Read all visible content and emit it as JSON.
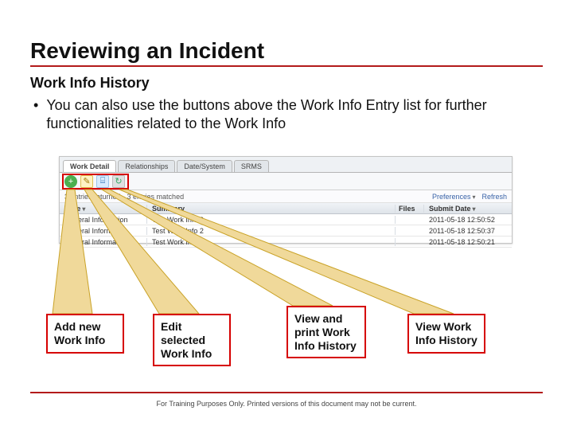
{
  "title": "Reviewing an Incident",
  "subtitle": "Work Info History",
  "bullet": "You can also use the buttons above the Work Info Entry list for further functionalities related to the Work Info",
  "footer": "For Training Purposes Only. Printed versions of this document may not be current.",
  "panel": {
    "tabs": [
      "Work Detail",
      "Relationships",
      "Date/System",
      "SRMS"
    ],
    "active_tab": 0,
    "status_left": "3 entries returned - 3 entries matched",
    "status_preferences": "Preferences",
    "status_refresh": "Refresh",
    "columns": {
      "type": "Type",
      "summary": "Summary",
      "files": "Files",
      "date": "Submit Date"
    },
    "rows": [
      {
        "type": "General Information",
        "summary": "Test Work Info 3",
        "files": "",
        "date": "2011-05-18 12:50:52"
      },
      {
        "type": "General Information",
        "summary": "Test Work Info 2",
        "files": "",
        "date": "2011-05-18 12:50:37"
      },
      {
        "type": "General Information",
        "summary": "Test Work Info 1",
        "files": "",
        "date": "2011-05-18 12:50:21"
      }
    ],
    "icons": {
      "add": "+",
      "edit": "✎",
      "view": "⌸",
      "history": "↻"
    }
  },
  "callouts": {
    "add": "Add new Work Info",
    "edit": "Edit selected Work Info",
    "view": "View and print Work Info History",
    "hist": "View Work Info History"
  }
}
